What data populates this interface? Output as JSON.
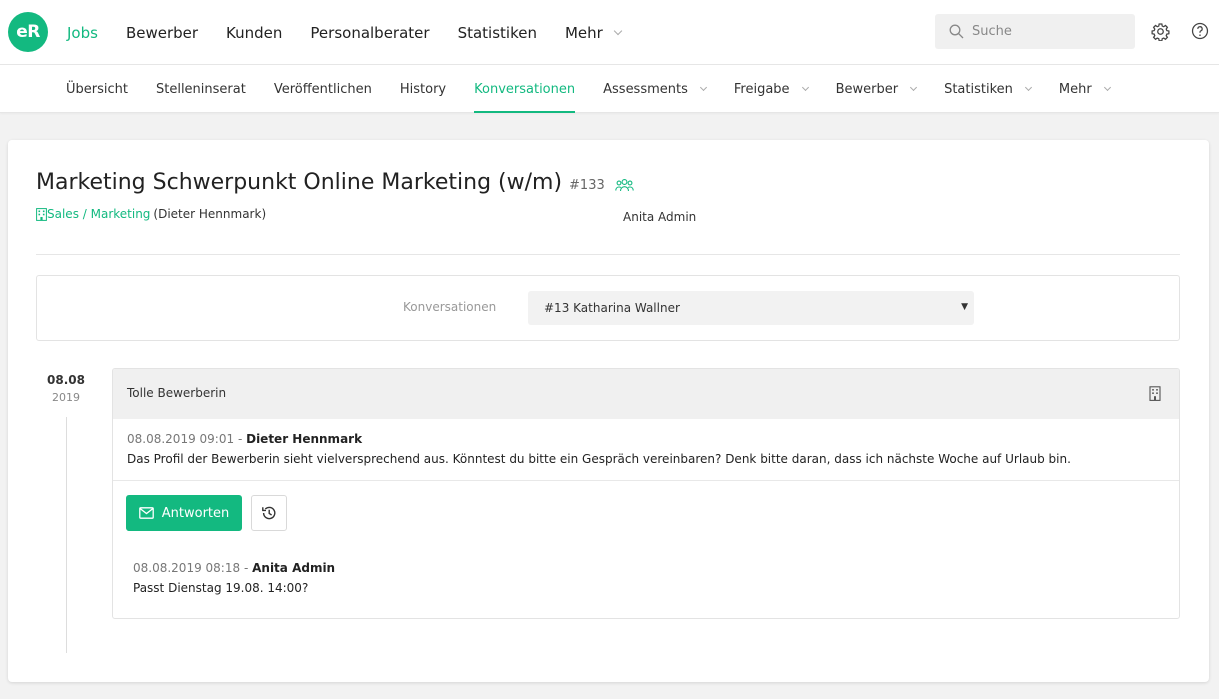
{
  "app": {
    "logo_text": "eR",
    "brand_color": "#13b980"
  },
  "topnav": {
    "items": [
      {
        "label": "Jobs",
        "active": true
      },
      {
        "label": "Bewerber"
      },
      {
        "label": "Kunden"
      },
      {
        "label": "Personalberater"
      },
      {
        "label": "Statistiken"
      },
      {
        "label": "Mehr",
        "dropdown": true
      }
    ],
    "search_placeholder": "Suche",
    "icons": [
      "search-icon",
      "gear-icon",
      "help-icon"
    ]
  },
  "subnav": {
    "items": [
      {
        "label": "Übersicht"
      },
      {
        "label": "Stelleninserat"
      },
      {
        "label": "Veröffentlichen"
      },
      {
        "label": "History"
      },
      {
        "label": "Konversationen",
        "active": true
      },
      {
        "label": "Assessments",
        "dropdown": true
      },
      {
        "label": "Freigabe",
        "dropdown": true
      },
      {
        "label": "Bewerber",
        "dropdown": true
      },
      {
        "label": "Statistiken",
        "dropdown": true
      },
      {
        "label": "Mehr",
        "dropdown": true
      }
    ]
  },
  "job": {
    "title": "Marketing Schwerpunkt Online Marketing (w/m)",
    "id": "#133",
    "department": "Sales / Marketing",
    "owner": "(Dieter Hennmark)",
    "assignee": "Anita Admin"
  },
  "conversations": {
    "label": "Konversationen",
    "selected": "#13 Katharina Wallner"
  },
  "timeline": {
    "date_day": "08.08",
    "date_year": "2019"
  },
  "thread": {
    "subject": "Tolle Bewerberin",
    "messages": [
      {
        "timestamp": "08.08.2019 09:01",
        "separator": "-",
        "author": "Dieter Hennmark",
        "body": "Das Profil der Bewerberin sieht vielversprechend aus. Könntest du bitte ein Gespräch vereinbaren? Denk bitte daran, dass ich nächste Woche auf Urlaub bin."
      },
      {
        "timestamp": "08.08.2019 08:18",
        "separator": "-",
        "author": "Anita Admin",
        "body": "Passt Dienstag 19.08. 14:00?"
      }
    ],
    "reply_label": "Antworten"
  }
}
